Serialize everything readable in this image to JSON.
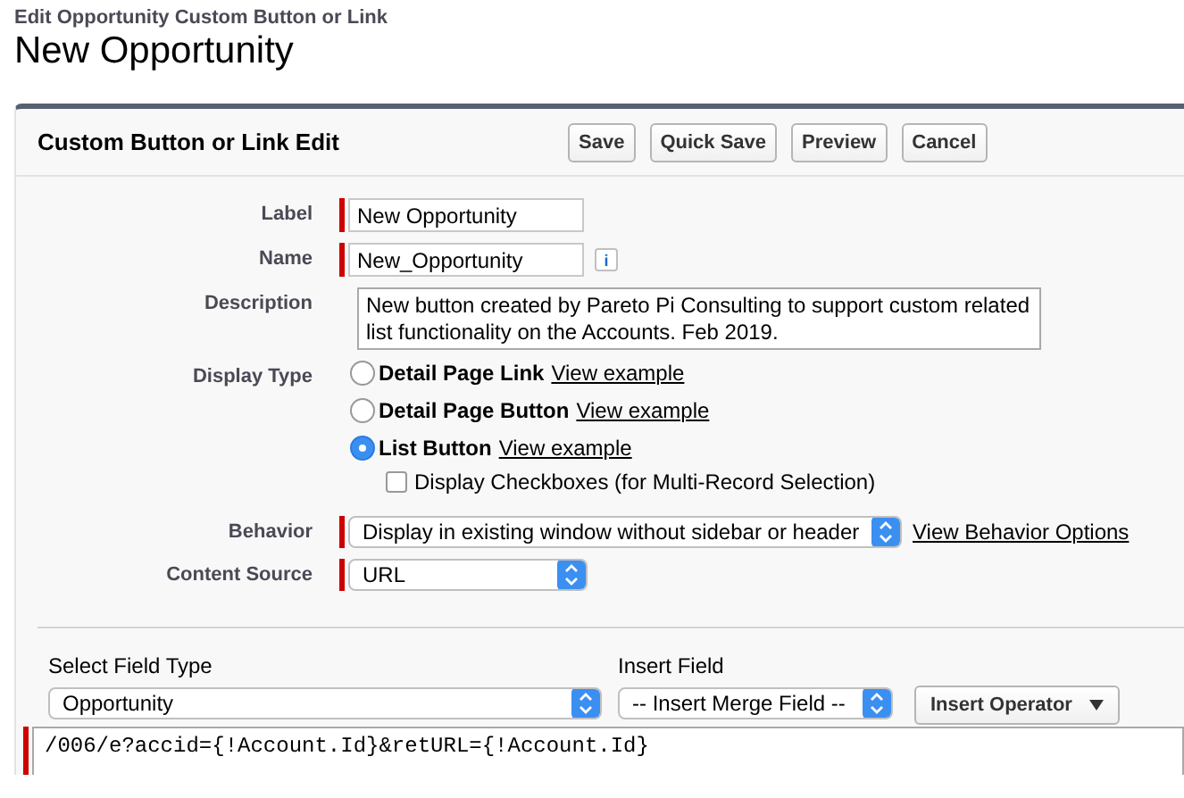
{
  "page": {
    "subtitle": "Edit Opportunity Custom Button or Link",
    "title": "New Opportunity"
  },
  "panel": {
    "title": "Custom Button or Link Edit",
    "buttons": [
      "Save",
      "Quick Save",
      "Preview",
      "Cancel"
    ]
  },
  "fields": [
    {
      "kind": "text",
      "label": "Label",
      "value": "New Opportunity",
      "required": true
    },
    {
      "kind": "text",
      "label": "Name",
      "value": "New_Opportunity",
      "required": true,
      "info": "i"
    },
    {
      "kind": "textarea",
      "label": "Description",
      "value": "New button created by Pareto Pi Consulting to support custom related list functionality on the Accounts. Feb 2019.",
      "required": false
    },
    {
      "kind": "radio",
      "label": "Display Type",
      "options": [
        {
          "name": "Detail Page Link",
          "link": "View example",
          "selected": false
        },
        {
          "name": "Detail Page Button",
          "link": "View example",
          "selected": false
        },
        {
          "name": "List Button",
          "link": "View example",
          "selected": true
        }
      ],
      "checkbox": {
        "label": "Display Checkboxes (for Multi-Record Selection)",
        "checked": false
      }
    },
    {
      "kind": "select",
      "label": "Behavior",
      "value": "Display in existing window without sidebar or header",
      "required": true,
      "link": "View Behavior Options",
      "wide": true
    },
    {
      "kind": "select",
      "label": "Content Source",
      "value": "URL",
      "required": true,
      "wide": false
    }
  ],
  "formula": {
    "field_type": {
      "label": "Select Field Type",
      "value": "Opportunity"
    },
    "insert_field": {
      "label": "Insert Field",
      "value": "-- Insert Merge Field --"
    },
    "operator_button": "Insert Operator",
    "code": "/006/e?accid={!Account.Id}&retURL={!Account.Id}",
    "required": true
  }
}
